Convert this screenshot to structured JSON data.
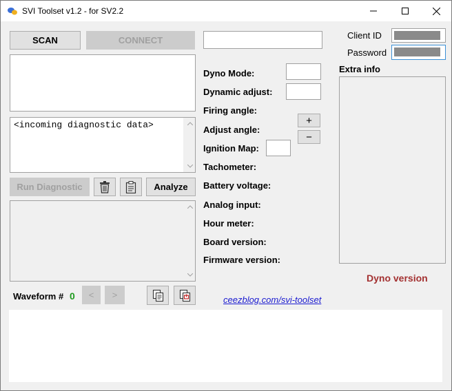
{
  "window": {
    "title": "SVI Toolset v1.2 - for SV2.2"
  },
  "buttons": {
    "scan": "SCAN",
    "connect": "CONNECT",
    "run_diagnostic": "Run Diagnostic",
    "analyze": "Analyze",
    "plus": "+",
    "minus": "−",
    "prev": "<",
    "next": ">"
  },
  "diagnostic": {
    "placeholder_text": "<incoming diagnostic data>"
  },
  "fields": {
    "dyno_mode": "Dyno Mode:",
    "dynamic_adjust": "Dynamic adjust:",
    "firing_angle": "Firing angle:",
    "adjust_angle": "Adjust angle:",
    "ignition_map": "Ignition Map:",
    "tachometer": "Tachometer:",
    "battery_voltage": "Battery voltage:",
    "analog_input": "Analog input:",
    "hour_meter": "Hour meter:",
    "board_version": "Board version:",
    "firmware_version": "Firmware version:"
  },
  "auth": {
    "client_id_label": "Client ID",
    "password_label": "Password"
  },
  "extra_info": {
    "label": "Extra info"
  },
  "waveform": {
    "label": "Waveform #",
    "value": "0"
  },
  "footer": {
    "link": "ceezblog.com/svi-toolset",
    "version": "Dyno version"
  },
  "colors": {
    "waveform_value": "#1e9a1e",
    "link": "#1a1ad0",
    "version": "#a33030",
    "masked_field": "#8a8a8a",
    "focus_border": "#3a8fd6"
  },
  "icons": {
    "app": "app-icon",
    "minimize": "minimize-icon",
    "maximize": "maximize-icon",
    "close": "close-icon",
    "trash": "trash-icon",
    "clipboard": "clipboard-icon",
    "copy": "copy-icon",
    "export": "export-icon"
  }
}
